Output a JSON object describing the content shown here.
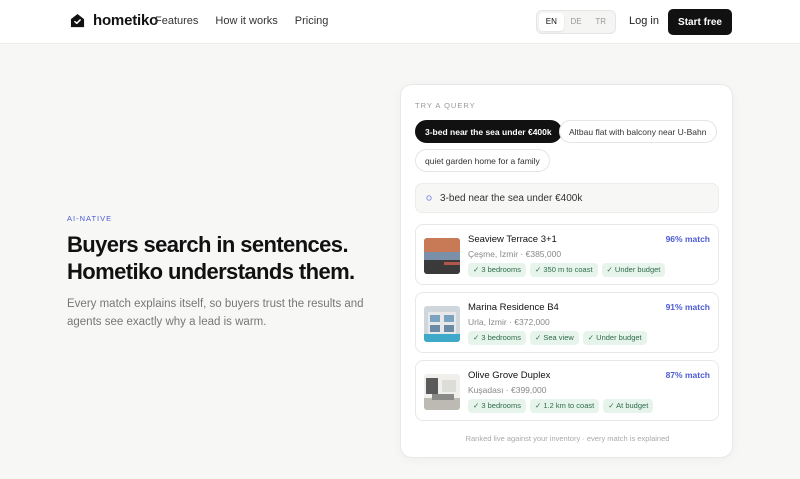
{
  "brand": {
    "name": "hometiko"
  },
  "nav": [
    {
      "label": "Features"
    },
    {
      "label": "How it works"
    },
    {
      "label": "Pricing"
    }
  ],
  "lang": {
    "options": [
      "EN",
      "DE",
      "TR"
    ],
    "selected": "EN"
  },
  "header": {
    "login_label": "Log in",
    "cta_label": "Start free"
  },
  "hero": {
    "eyebrow": "AI-NATIVE",
    "headline_line1": "Buyers search in sentences.",
    "headline_line2": "Hometiko understands them.",
    "sub": "Every match explains itself, so buyers trust the results and agents see exactly why a lead is warm."
  },
  "demo": {
    "label": "TRY A QUERY",
    "chips": [
      {
        "label": "3-bed near the sea under €400k",
        "active": true
      },
      {
        "label": "Altbau flat with balcony near U-Bahn",
        "active": false
      },
      {
        "label": "quiet garden home for a family",
        "active": false
      }
    ],
    "query": "3-bed near the sea under €400k",
    "listings": [
      {
        "name": "Seaview Terrace 3+1",
        "location": "Çeşme, İzmir · €385,000",
        "match": "96% match",
        "tags": [
          "✓ 3 bedrooms",
          "✓ 350 m to coast",
          "✓ Under budget"
        ]
      },
      {
        "name": "Marina Residence B4",
        "location": "Urla, İzmir · €372,000",
        "match": "91% match",
        "tags": [
          "✓ 3 bedrooms",
          "✓ Sea view",
          "✓ Under budget"
        ]
      },
      {
        "name": "Olive Grove Duplex",
        "location": "Kuşadası · €399,000",
        "match": "87% match",
        "tags": [
          "✓ 3 bedrooms",
          "✓ 1.2 km to coast",
          "✓ At budget"
        ]
      }
    ],
    "footnote": "Ranked live against your inventory · every match is explained"
  },
  "colors": {
    "accent": "#4b5bd4",
    "tag_bg": "#e6f4ec",
    "tag_text": "#2f6b48",
    "primary": "#111111"
  }
}
